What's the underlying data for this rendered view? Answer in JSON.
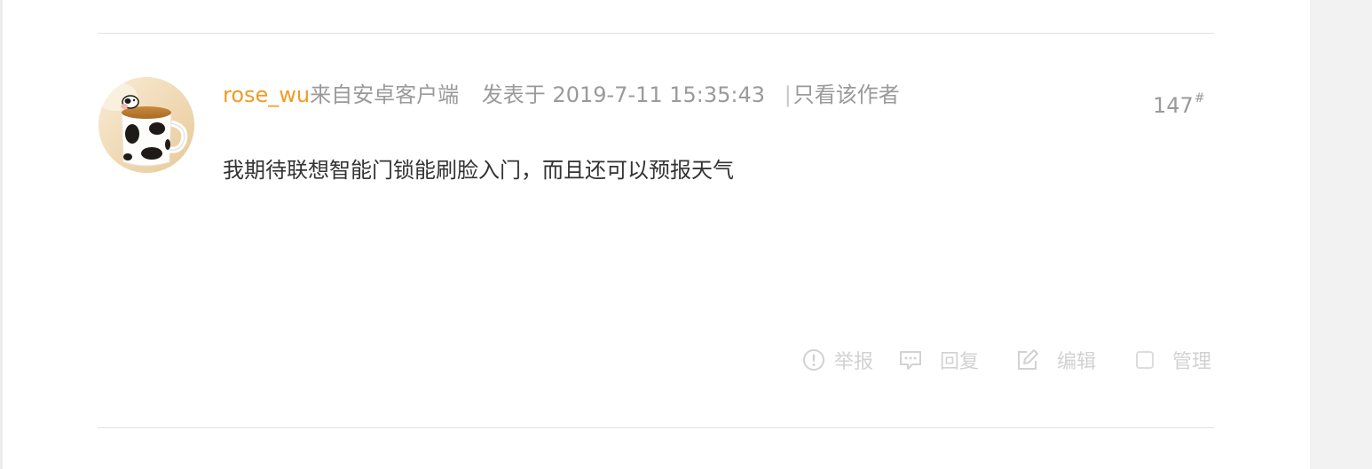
{
  "post": {
    "author": "rose_wu",
    "client_source": "来自安卓客户端",
    "posted_label": "发表于",
    "posted_time": "2019-7-11 15:35:43",
    "only_author_sep": "|",
    "only_author_label": "只看该作者",
    "floor": "147",
    "floor_mark": "#",
    "body": "我期待联想智能门锁能刷脸入门，而且还可以预报天气"
  },
  "actions": {
    "report_label": "举报",
    "reply_label": "回复",
    "edit_label": "编辑",
    "manage_label": "管理"
  },
  "icons": {
    "avatar": "cow-mug-avatar",
    "report": "exclamation-circle-icon",
    "reply": "chat-bubble-icon",
    "edit": "edit-pencil-icon",
    "manage": "checkbox-icon"
  },
  "colors": {
    "author": "#f39b23",
    "meta_text": "#9a9a9a",
    "body_text": "#333333",
    "action_text": "#d2d2d2",
    "divider": "#e2e2e2",
    "page_bg": "#f2f2f2"
  }
}
